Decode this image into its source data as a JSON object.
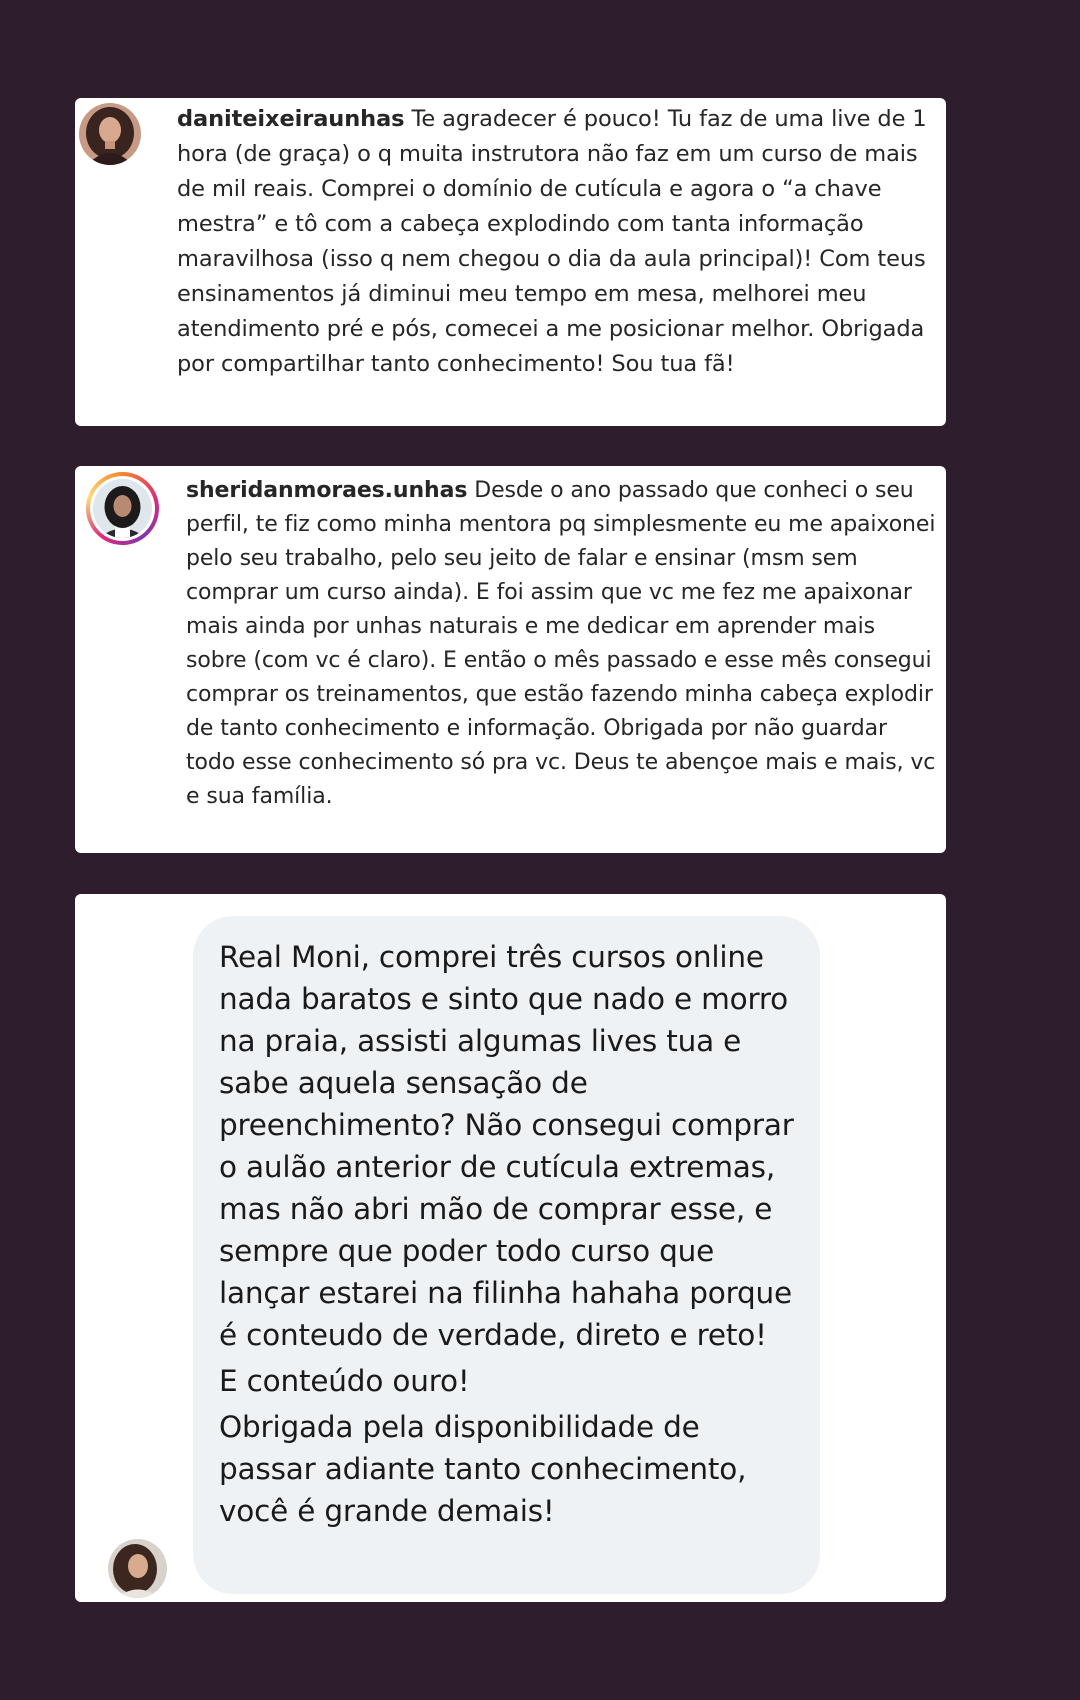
{
  "comments": [
    {
      "username": "daniteixeiraunhas",
      "text": "Te agradecer é pouco! Tu faz de uma live de 1 hora (de graça) o q muita instrutora não faz em um curso de mais de mil reais. Comprei o domínio de cutícula e agora o “a chave mestra” e tô com a cabeça explodindo com tanta informação maravilhosa (isso q nem chegou o dia da aula principal)! Com teus ensinamentos já diminui meu tempo em mesa, melhorei meu atendimento pré e pós, comecei a me posicionar melhor. Obrigada por compartilhar tanto conhecimento! Sou tua fã!",
      "avatar_icon": "profile-photo-icon"
    },
    {
      "username": "sheridanmoraes.unhas",
      "text": "Desde o ano passado que conheci o seu perfil, te fiz como minha mentora pq simplesmente eu me apaixonei pelo seu trabalho, pelo seu jeito de falar e ensinar (msm sem comprar um curso ainda). E foi assim que vc me fez me apaixonar mais ainda por unhas naturais e me dedicar em aprender mais sobre (com vc é claro). E então o mês passado e esse mês consegui comprar os treinamentos, que estão fazendo minha cabeça explodir de tanto conhecimento e informação. Obrigada por não guardar todo esse conhecimento só pra vc. Deus te abençoe mais e mais, vc e sua família.",
      "avatar_icon": "profile-photo-story-ring-icon"
    }
  ],
  "message": {
    "paragraphs": [
      "Real Moni, comprei três cursos online nada baratos e sinto que nado e morro na praia, assisti algumas lives tua e sabe aquela sensação de preenchimento? Não consegui comprar o aulão anterior de cutícula extremas, mas não abri mão de comprar esse, e sempre que poder todo curso que lançar estarei na filinha hahaha porque é conteudo de verdade, direto e reto!",
      "E conteúdo ouro!",
      "Obrigada pela disponibilidade de passar adiante tanto conhecimento, você é grande demais!"
    ],
    "avatar_icon": "sender-photo-icon"
  },
  "colors": {
    "background": "#2e1d2c",
    "card": "#ffffff",
    "bubble": "#eff2f4",
    "text": "#262626"
  }
}
